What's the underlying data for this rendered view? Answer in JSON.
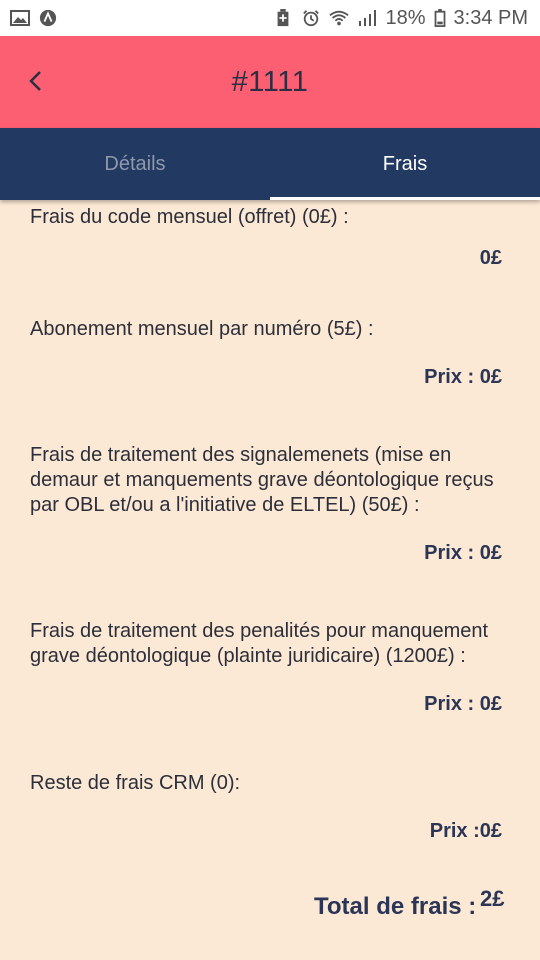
{
  "status_bar": {
    "battery": "18%",
    "time": "3:34 PM",
    "icons": [
      "image-icon",
      "app-notification-icon",
      "battery-saver-icon",
      "alarm-icon",
      "wifi-icon",
      "signal-icon",
      "battery-icon"
    ]
  },
  "header": {
    "title": "#1111",
    "back_icon": "chevron-left-icon"
  },
  "tabs": [
    {
      "label": "Détails",
      "active": false
    },
    {
      "label": "Frais",
      "active": true
    }
  ],
  "fees": [
    {
      "label": "Frais du code mensuel (offret) (0£) :",
      "value": "0£"
    },
    {
      "label": "Abonement mensuel par numéro (5£) :",
      "value": "Prix : 0£"
    },
    {
      "label": "Frais de traitement des signalemenets (mise en demaur et manquements grave déontologique reçus par OBL et/ou a l'initiative de ELTEL) (50£) :",
      "value": "Prix : 0£"
    },
    {
      "label": "Frais de traitement des penalités pour manquement grave déontologique (plainte juridicaire) (1200£) :",
      "value": "Prix : 0£"
    },
    {
      "label": "Reste de frais CRM (0):",
      "value": "Prix :0£"
    }
  ],
  "total": {
    "label": "Total de frais :",
    "value": "2£"
  },
  "colors": {
    "header": "#fc5f72",
    "tabs": "#223a61",
    "background": "#fbe8d5",
    "value_text": "#2b3656"
  }
}
